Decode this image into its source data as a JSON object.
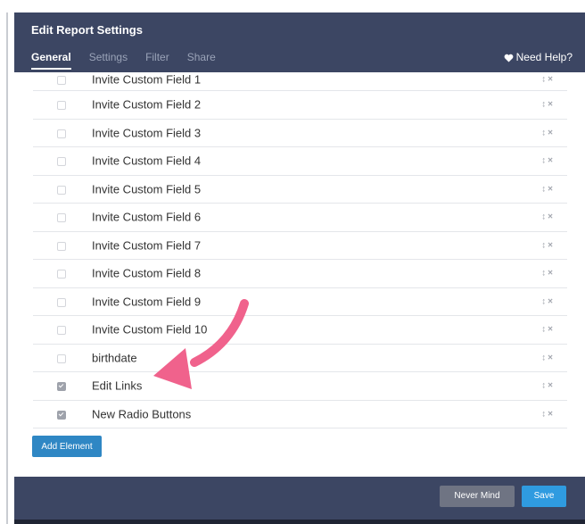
{
  "modal": {
    "title": "Edit Report Settings",
    "tabs": [
      {
        "label": "General",
        "active": true
      },
      {
        "label": "Settings"
      },
      {
        "label": "Filter"
      },
      {
        "label": "Share"
      }
    ],
    "help_label": "Need Help?"
  },
  "elements": [
    {
      "label": "Invite Custom Field 1",
      "checked": false
    },
    {
      "label": "Invite Custom Field 2",
      "checked": false
    },
    {
      "label": "Invite Custom Field 3",
      "checked": false
    },
    {
      "label": "Invite Custom Field 4",
      "checked": false
    },
    {
      "label": "Invite Custom Field 5",
      "checked": false
    },
    {
      "label": "Invite Custom Field 6",
      "checked": false
    },
    {
      "label": "Invite Custom Field 7",
      "checked": false
    },
    {
      "label": "Invite Custom Field 8",
      "checked": false
    },
    {
      "label": "Invite Custom Field 9",
      "checked": false
    },
    {
      "label": "Invite Custom Field 10",
      "checked": false
    },
    {
      "label": "birthdate",
      "checked": false
    },
    {
      "label": "Edit Links",
      "checked": true
    },
    {
      "label": "New Radio Buttons",
      "checked": true
    }
  ],
  "row_actions": {
    "move_icon": "↕",
    "remove_icon": "×"
  },
  "add_button": "Add Element",
  "footer": {
    "cancel_label": "Never Mind",
    "save_label": "Save"
  },
  "annotation": {
    "icon": "pink-curved-arrow",
    "color": "#f0628c"
  }
}
